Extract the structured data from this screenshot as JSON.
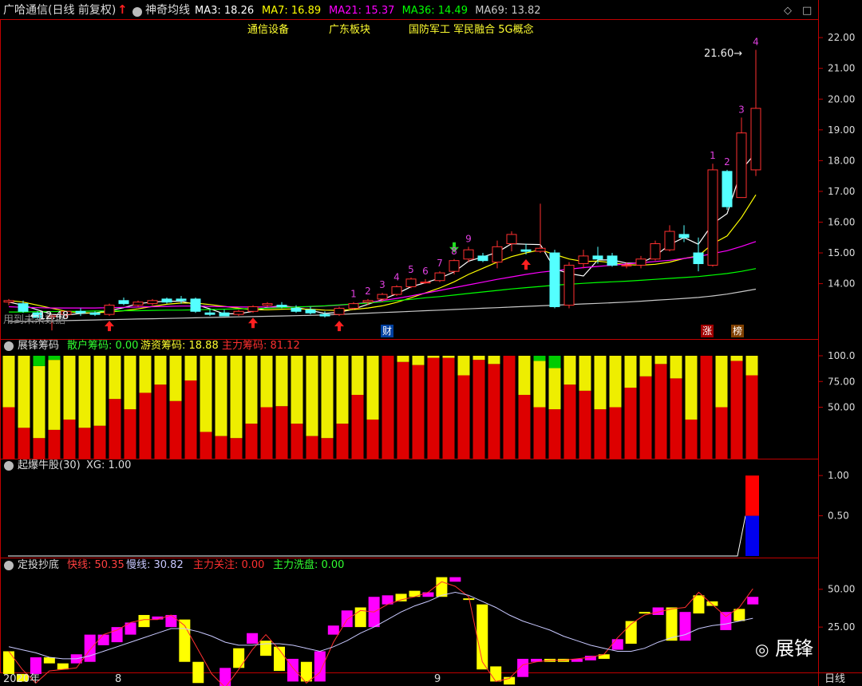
{
  "header": {
    "title": "广哈通信(日线 前复权)",
    "indicator_name": "神奇均线",
    "ma": [
      {
        "label": "MA3: 18.26",
        "color": "#ffffff"
      },
      {
        "label": "MA7: 16.89",
        "color": "#ffff00"
      },
      {
        "label": "MA21: 15.37",
        "color": "#ff00ff"
      },
      {
        "label": "MA36: 14.49",
        "color": "#00ff00"
      },
      {
        "label": "MA69: 13.82",
        "color": "#c8c8c8"
      }
    ],
    "concepts": [
      "通信设备",
      "广东板块",
      "国防军工 军民融合 5G概念"
    ]
  },
  "main_panel": {
    "y_ticks": [
      "22.00",
      "21.00",
      "20.00",
      "19.00",
      "18.00",
      "17.00",
      "16.00",
      "15.00",
      "14.00"
    ],
    "high_label": "21.60",
    "low_label": "12.48",
    "future_data_note": "用到未来数据",
    "tag_cai": "财",
    "tag_zhang": "涨",
    "tag_bang": "榜"
  },
  "panel2": {
    "title": "展锋筹码",
    "retail": "散户筹码: 0.00",
    "hot": "游资筹码: 18.88",
    "main": "主力筹码: 81.12",
    "y_ticks": [
      "100.0",
      "75.00",
      "50.00"
    ]
  },
  "panel3": {
    "title": "起爆牛股(30)",
    "xg": "XG: 1.00",
    "y_ticks": [
      "1.00",
      "0.50"
    ]
  },
  "panel4": {
    "title": "定投抄底",
    "fast": "快线: 50.35",
    "slow": "慢线: 30.82",
    "focus": "主力关注: 0.00",
    "wash": "主力洗盘: 0.00",
    "y_ticks": [
      "50.00",
      "25.00"
    ]
  },
  "xaxis": {
    "labels": [
      "2020年",
      "8",
      "9"
    ],
    "period": "日线"
  },
  "watermark": "展锋",
  "chart_data": [
    {
      "type": "candlestick",
      "title": "广哈通信(日线 前复权)",
      "ylim": [
        12.2,
        22.6
      ],
      "ohlc": [
        [
          13.4,
          13.5,
          13.3,
          13.45
        ],
        [
          13.35,
          13.45,
          13.05,
          13.1
        ],
        [
          13.05,
          13.1,
          12.85,
          12.9
        ],
        [
          12.95,
          13.0,
          12.48,
          12.95
        ],
        [
          13.0,
          13.1,
          12.9,
          13.1
        ],
        [
          13.1,
          13.2,
          12.95,
          13.05
        ],
        [
          13.05,
          13.1,
          12.95,
          13.0
        ],
        [
          13.0,
          13.35,
          12.95,
          13.3
        ],
        [
          13.45,
          13.55,
          13.3,
          13.35
        ],
        [
          13.3,
          13.45,
          13.25,
          13.4
        ],
        [
          13.35,
          13.5,
          13.3,
          13.45
        ],
        [
          13.5,
          13.55,
          13.35,
          13.4
        ],
        [
          13.5,
          13.6,
          13.35,
          13.45
        ],
        [
          13.5,
          13.55,
          13.05,
          13.1
        ],
        [
          13.05,
          13.15,
          12.95,
          13.0
        ],
        [
          13.05,
          13.15,
          12.95,
          12.95
        ],
        [
          13.0,
          13.15,
          12.95,
          13.1
        ],
        [
          13.1,
          13.3,
          13.05,
          13.25
        ],
        [
          13.3,
          13.4,
          13.25,
          13.35
        ],
        [
          13.3,
          13.4,
          13.2,
          13.25
        ],
        [
          13.2,
          13.3,
          13.05,
          13.1
        ],
        [
          13.15,
          13.25,
          13.0,
          13.05
        ],
        [
          13.0,
          13.1,
          12.9,
          12.95
        ],
        [
          13.0,
          13.25,
          12.95,
          13.2
        ],
        [
          13.2,
          13.4,
          13.15,
          13.35
        ],
        [
          13.4,
          13.5,
          13.3,
          13.45
        ],
        [
          13.5,
          13.7,
          13.4,
          13.65
        ],
        [
          13.65,
          13.95,
          13.6,
          13.9
        ],
        [
          13.9,
          14.2,
          13.85,
          14.15
        ],
        [
          14.05,
          14.15,
          14.0,
          14.05
        ],
        [
          14.1,
          14.4,
          14.05,
          14.35
        ],
        [
          14.4,
          14.8,
          14.3,
          14.75
        ],
        [
          14.8,
          15.2,
          14.7,
          15.1
        ],
        [
          14.9,
          15.0,
          14.7,
          14.75
        ],
        [
          14.7,
          15.4,
          14.5,
          15.2
        ],
        [
          15.3,
          15.7,
          15.05,
          15.6
        ],
        [
          15.1,
          15.3,
          14.95,
          15.05
        ],
        [
          15.05,
          16.6,
          15.0,
          15.15
        ],
        [
          15.0,
          15.1,
          13.2,
          13.25
        ],
        [
          13.3,
          14.7,
          13.2,
          14.6
        ],
        [
          14.65,
          15.1,
          14.5,
          14.9
        ],
        [
          14.9,
          15.2,
          14.65,
          14.8
        ],
        [
          14.9,
          15.0,
          14.55,
          14.6
        ],
        [
          14.6,
          14.7,
          14.5,
          14.6
        ],
        [
          14.6,
          14.9,
          14.5,
          14.8
        ],
        [
          14.8,
          15.4,
          14.75,
          15.3
        ],
        [
          15.1,
          15.9,
          15.05,
          15.7
        ],
        [
          15.6,
          15.9,
          15.35,
          15.5
        ],
        [
          15.0,
          15.5,
          14.4,
          14.65
        ],
        [
          14.6,
          17.9,
          14.55,
          17.7
        ],
        [
          17.65,
          17.7,
          16.4,
          16.5
        ],
        [
          16.8,
          19.4,
          16.8,
          18.9
        ],
        [
          17.7,
          21.6,
          17.5,
          19.7
        ]
      ],
      "moving_averages": {
        "MA3": [
          13.4,
          13.3,
          13.15,
          13.0,
          12.98,
          13.03,
          13.05,
          13.12,
          13.22,
          13.35,
          13.4,
          13.43,
          13.43,
          13.32,
          13.18,
          13.02,
          13.02,
          13.1,
          13.23,
          13.28,
          13.23,
          13.13,
          13.03,
          13.07,
          13.17,
          13.33,
          13.48,
          13.67,
          13.9,
          14.03,
          14.18,
          14.38,
          14.73,
          14.87,
          15.02,
          15.3,
          15.28,
          15.27,
          14.48,
          14.33,
          14.25,
          14.77,
          14.77,
          14.67,
          14.67,
          14.9,
          15.27,
          15.5,
          15.28,
          15.95,
          16.28,
          17.7,
          18.26
        ],
        "MA7": [
          13.45,
          13.4,
          13.3,
          13.2,
          13.1,
          13.05,
          13.05,
          13.08,
          13.12,
          13.18,
          13.26,
          13.33,
          13.37,
          13.37,
          13.32,
          13.26,
          13.2,
          13.15,
          13.15,
          13.17,
          13.18,
          13.17,
          13.14,
          13.13,
          13.16,
          13.21,
          13.28,
          13.39,
          13.54,
          13.7,
          13.86,
          14.06,
          14.3,
          14.5,
          14.7,
          14.88,
          15.0,
          15.1,
          14.95,
          14.8,
          14.72,
          14.73,
          14.68,
          14.62,
          14.6,
          14.63,
          14.7,
          14.82,
          14.9,
          15.3,
          15.55,
          16.15,
          16.89
        ],
        "MA21": [
          13.25,
          13.23,
          13.22,
          13.21,
          13.21,
          13.21,
          13.21,
          13.22,
          13.23,
          13.24,
          13.25,
          13.26,
          13.27,
          13.27,
          13.26,
          13.25,
          13.24,
          13.24,
          13.24,
          13.24,
          13.24,
          13.25,
          13.27,
          13.3,
          13.34,
          13.39,
          13.45,
          13.52,
          13.6,
          13.69,
          13.78,
          13.87,
          13.96,
          14.05,
          14.14,
          14.22,
          14.3,
          14.37,
          14.42,
          14.47,
          14.52,
          14.56,
          14.6,
          14.64,
          14.68,
          14.72,
          14.76,
          14.82,
          14.88,
          14.98,
          15.07,
          15.21,
          15.37
        ],
        "MA36": [
          13.08,
          13.08,
          13.09,
          13.09,
          13.1,
          13.1,
          13.11,
          13.11,
          13.12,
          13.12,
          13.13,
          13.14,
          13.14,
          13.15,
          13.16,
          13.17,
          13.18,
          13.19,
          13.2,
          13.22,
          13.24,
          13.26,
          13.28,
          13.31,
          13.34,
          13.37,
          13.41,
          13.45,
          13.49,
          13.54,
          13.58,
          13.63,
          13.68,
          13.73,
          13.78,
          13.83,
          13.87,
          13.91,
          13.95,
          13.98,
          14.01,
          14.04,
          14.06,
          14.08,
          14.11,
          14.14,
          14.17,
          14.2,
          14.23,
          14.28,
          14.33,
          14.4,
          14.49
        ],
        "MA69": [
          12.76,
          12.77,
          12.78,
          12.79,
          12.8,
          12.81,
          12.82,
          12.83,
          12.84,
          12.85,
          12.86,
          12.87,
          12.88,
          12.89,
          12.9,
          12.91,
          12.92,
          12.93,
          12.94,
          12.95,
          12.96,
          12.97,
          12.98,
          13.0,
          13.02,
          13.04,
          13.06,
          13.08,
          13.1,
          13.12,
          13.14,
          13.16,
          13.18,
          13.2,
          13.22,
          13.24,
          13.26,
          13.28,
          13.3,
          13.32,
          13.34,
          13.36,
          13.38,
          13.4,
          13.43,
          13.46,
          13.49,
          13.52,
          13.55,
          13.6,
          13.66,
          13.74,
          13.82
        ]
      },
      "buy_arrows_at": [
        7,
        17,
        23,
        36
      ],
      "sell_arrows_at": [
        31
      ],
      "count_labels": [
        {
          "i": 24,
          "text": "1"
        },
        {
          "i": 25,
          "text": "2"
        },
        {
          "i": 26,
          "text": "3"
        },
        {
          "i": 27,
          "text": "4"
        },
        {
          "i": 28,
          "text": "5"
        },
        {
          "i": 29,
          "text": "6"
        },
        {
          "i": 30,
          "text": "7"
        },
        {
          "i": 31,
          "text": "8"
        },
        {
          "i": 32,
          "text": "9"
        },
        {
          "i": 49,
          "text": "1"
        },
        {
          "i": 50,
          "text": "2"
        },
        {
          "i": 51,
          "text": "3"
        },
        {
          "i": 52,
          "text": "4"
        }
      ]
    },
    {
      "type": "stacked_bar",
      "title": "展锋筹码",
      "ylim": [
        0,
        100
      ],
      "series": [
        {
          "name": "主力筹码",
          "color": "#dd0000",
          "values": [
            50,
            30,
            20,
            28,
            38,
            30,
            32,
            58,
            48,
            64,
            72,
            56,
            76,
            26,
            22,
            20,
            34,
            50,
            51,
            34,
            22,
            20,
            34,
            62,
            38,
            100,
            94,
            91,
            98,
            98,
            81,
            96,
            92,
            100,
            62,
            50,
            48,
            72,
            66,
            48,
            50,
            69,
            80,
            92,
            78,
            38,
            100,
            50,
            95,
            81
          ]
        },
        {
          "name": "游资筹码",
          "color": "#eeee00",
          "values": [
            50,
            70,
            70,
            68,
            62,
            70,
            68,
            42,
            52,
            36,
            28,
            44,
            24,
            74,
            78,
            80,
            66,
            50,
            49,
            66,
            78,
            80,
            66,
            38,
            62,
            0,
            6,
            9,
            2,
            2,
            19,
            4,
            8,
            0,
            38,
            45,
            40,
            28,
            34,
            52,
            50,
            31,
            20,
            8,
            22,
            62,
            0,
            50,
            5,
            19
          ]
        },
        {
          "name": "散户筹码",
          "color": "#00cc00",
          "values": [
            0,
            0,
            10,
            4,
            0,
            0,
            0,
            0,
            0,
            0,
            0,
            0,
            0,
            0,
            0,
            0,
            0,
            0,
            0,
            0,
            0,
            0,
            0,
            0,
            0,
            0,
            0,
            0,
            0,
            0,
            0,
            0,
            0,
            0,
            0,
            5,
            12,
            0,
            0,
            0,
            0,
            0,
            0,
            0,
            0,
            0,
            0,
            0,
            0,
            0
          ]
        }
      ]
    },
    {
      "type": "bar",
      "title": "起爆牛股(30)",
      "ylim": [
        0,
        1.2
      ],
      "xg": 1.0,
      "last_bar_split": 0.5
    },
    {
      "type": "bar_line",
      "title": "定投抄底",
      "ylim": [
        -5,
        62
      ],
      "fast_line_color": "#ff3030",
      "slow_line_color": "#c8c8ff",
      "bars": [
        [
          9,
          -6
        ],
        [
          -6,
          -11
        ],
        [
          5,
          -6
        ],
        [
          5,
          1
        ],
        [
          1,
          -3
        ],
        [
          7,
          1
        ],
        [
          2,
          20
        ],
        [
          13,
          20
        ],
        [
          15,
          25
        ],
        [
          28,
          20
        ],
        [
          33,
          25
        ],
        [
          32,
          30
        ],
        [
          33,
          25
        ],
        [
          30,
          2
        ],
        [
          2,
          -12
        ],
        [
          -14,
          -17
        ],
        [
          -16,
          -2
        ],
        [
          -2,
          11
        ],
        [
          14,
          21
        ],
        [
          16,
          6
        ],
        [
          12,
          -4
        ],
        [
          4,
          -11
        ],
        [
          -11,
          2
        ],
        [
          9,
          -11
        ],
        [
          26,
          20
        ],
        [
          25,
          36
        ],
        [
          38,
          25
        ],
        [
          45,
          25
        ],
        [
          46,
          40
        ],
        [
          47,
          42
        ],
        [
          45,
          49
        ],
        [
          48,
          45
        ],
        [
          45,
          58
        ],
        [
          55,
          58
        ],
        [
          44,
          44
        ],
        [
          40,
          -3
        ],
        [
          -1,
          -11
        ],
        [
          -13,
          -8
        ],
        [
          -8,
          4
        ],
        [
          4,
          2
        ],
        [
          4,
          2
        ],
        [
          4,
          2
        ],
        [
          4,
          2
        ],
        [
          6,
          3
        ],
        [
          7,
          4
        ],
        [
          10,
          17
        ],
        [
          14,
          29
        ],
        [
          35,
          35
        ],
        [
          38,
          33
        ],
        [
          38,
          16
        ],
        [
          35,
          16
        ],
        [
          34,
          46
        ],
        [
          42,
          39
        ],
        [
          35,
          23
        ],
        [
          37,
          29
        ],
        [
          40,
          45
        ]
      ],
      "bar_colors": [
        "y",
        "y",
        "m",
        "y",
        "y",
        "m",
        "m",
        "m",
        "m",
        "m",
        "y",
        "m",
        "m",
        "y",
        "y",
        "y",
        "m",
        "y",
        "m",
        "y",
        "y",
        "m",
        "y",
        "m",
        "m",
        "m",
        "y",
        "m",
        "m",
        "y",
        "y",
        "m",
        "y",
        "m",
        "y",
        "y",
        "y",
        "y",
        "m",
        "m",
        "y",
        "y",
        "m",
        "m",
        "y",
        "m",
        "y",
        "y",
        "m",
        "y",
        "m",
        "y",
        "y",
        "m",
        "y",
        "m"
      ],
      "fast_line": [
        9,
        -3,
        -12,
        -4,
        -3,
        -2,
        10,
        20,
        23,
        28,
        30,
        30,
        33,
        26,
        10,
        -6,
        -15,
        -3,
        10,
        20,
        10,
        -2,
        -12,
        -5,
        15,
        30,
        36,
        35,
        40,
        43,
        45,
        48,
        55,
        52,
        45,
        2,
        -11,
        -9,
        0,
        2,
        3,
        3,
        4,
        5,
        7,
        18,
        27,
        33,
        35,
        37,
        38,
        48,
        40,
        32,
        38,
        50.35
      ],
      "slow_line": [
        12,
        10,
        8,
        5,
        4,
        4,
        6,
        9,
        12,
        15,
        18,
        21,
        24,
        24,
        22,
        19,
        15,
        13,
        13,
        14,
        14,
        13,
        11,
        9,
        12,
        16,
        21,
        25,
        30,
        35,
        39,
        42,
        46,
        48,
        46,
        42,
        38,
        33,
        29,
        26,
        23,
        19,
        16,
        13,
        11,
        9,
        9,
        11,
        15,
        18,
        20,
        24,
        26,
        27,
        29,
        30.82
      ]
    }
  ]
}
